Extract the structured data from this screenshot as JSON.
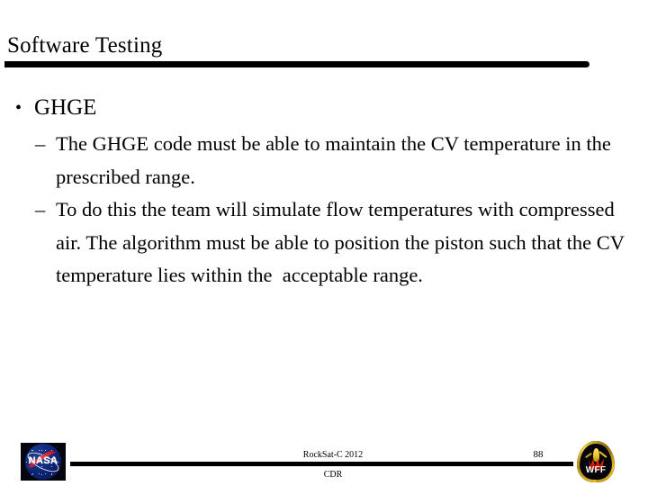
{
  "slide": {
    "title": "Software Testing",
    "bullets": [
      {
        "level": 1,
        "marker": "•",
        "text": "GHGE"
      },
      {
        "level": 2,
        "marker": "–",
        "text": "The GHGE code must be able to maintain the CV temperature in the prescribed range."
      },
      {
        "level": 2,
        "marker": "–",
        "text": "To do this the team will simulate flow temperatures with compressed air. The algorithm must be able to position the piston such that the CV temperature lies within the  acceptable range."
      }
    ]
  },
  "footer": {
    "project": "RockSat-C 2012",
    "review": "CDR",
    "page_number": "88",
    "left_logo_name": "nasa-logo",
    "left_logo_text": "NASA",
    "right_logo_name": "wff-logo",
    "right_logo_text": "WFF"
  },
  "colors": {
    "background": "#ffffff",
    "text": "#000000",
    "rule": "#000000",
    "nasa_blue": "#0d2372",
    "nasa_red": "#d4202c",
    "wff_gold": "#e8c020",
    "wff_red": "#d01000"
  }
}
